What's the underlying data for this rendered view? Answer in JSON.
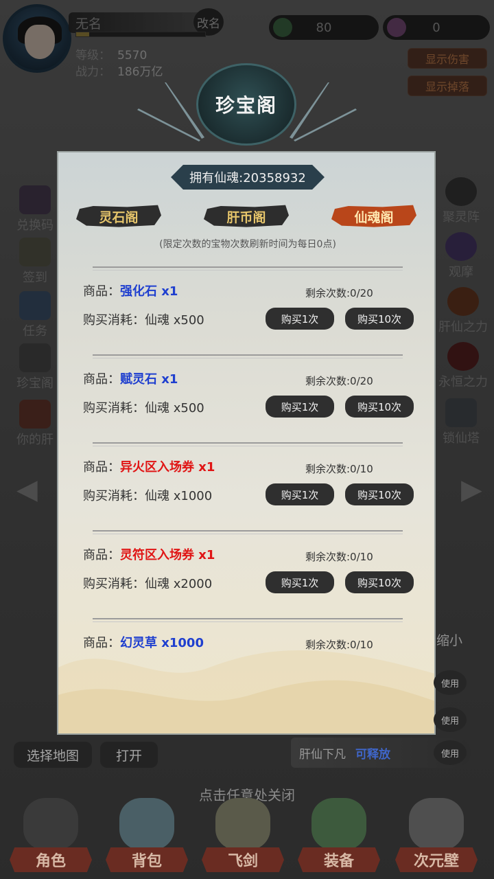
{
  "player": {
    "name": "无名",
    "rename": "改名",
    "level_label": "等级：",
    "level": "5570",
    "power_label": "战力：",
    "power": "186万亿"
  },
  "currency": {
    "gem_amount": "80",
    "soul_amount": "0"
  },
  "toggles": {
    "show_damage": "显示伤害",
    "show_drop": "显示掉落"
  },
  "left_menu": [
    {
      "label": "兑换码"
    },
    {
      "label": "签到"
    },
    {
      "label": "任务"
    },
    {
      "label": "珍宝阁"
    },
    {
      "label": "你的肝"
    }
  ],
  "right_menu": [
    {
      "label": "聚灵阵"
    },
    {
      "label": "观摩"
    },
    {
      "label": "肝仙之力"
    },
    {
      "label": "永恒之力"
    },
    {
      "label": "锁仙塔"
    }
  ],
  "modal": {
    "title": "珍宝阁",
    "soul_banner": "拥有仙魂:20358932",
    "tabs": [
      {
        "label": "灵石阁",
        "active": false
      },
      {
        "label": "肝币阁",
        "active": false
      },
      {
        "label": "仙魂阁",
        "active": true
      }
    ],
    "note": "(限定次数的宝物次数刷新时间为每日0点)",
    "item_label": "商品：",
    "cost_label": "购买消耗：",
    "buy1": "购买1次",
    "buy10": "购买10次",
    "items": [
      {
        "name": "强化石 x1",
        "color": "#1f3fcf",
        "remaining": "剩余次数:0/20",
        "cost": "仙魂 x500"
      },
      {
        "name": "赋灵石 x1",
        "color": "#1f3fcf",
        "remaining": "剩余次数:0/20",
        "cost": "仙魂 x500"
      },
      {
        "name": "异火区入场券 x1",
        "color": "#e01515",
        "remaining": "剩余次数:0/10",
        "cost": "仙魂 x1000"
      },
      {
        "name": "灵符区入场券 x1",
        "color": "#e01515",
        "remaining": "剩余次数:0/10",
        "cost": "仙魂 x2000"
      },
      {
        "name": "幻灵草 x1000",
        "color": "#1f3fcf",
        "remaining": "剩余次数:0/10",
        "cost": ""
      }
    ]
  },
  "controls": {
    "select_map": "选择地图",
    "open": "打开",
    "shrink": "缩小",
    "skill_name": "肝仙下凡",
    "skill_status": "可释放",
    "use": "使用",
    "close_hint": "点击任意处关闭"
  },
  "bottom_nav": [
    {
      "label": "角色"
    },
    {
      "label": "背包"
    },
    {
      "label": "飞剑"
    },
    {
      "label": "装备"
    },
    {
      "label": "次元壁"
    }
  ]
}
